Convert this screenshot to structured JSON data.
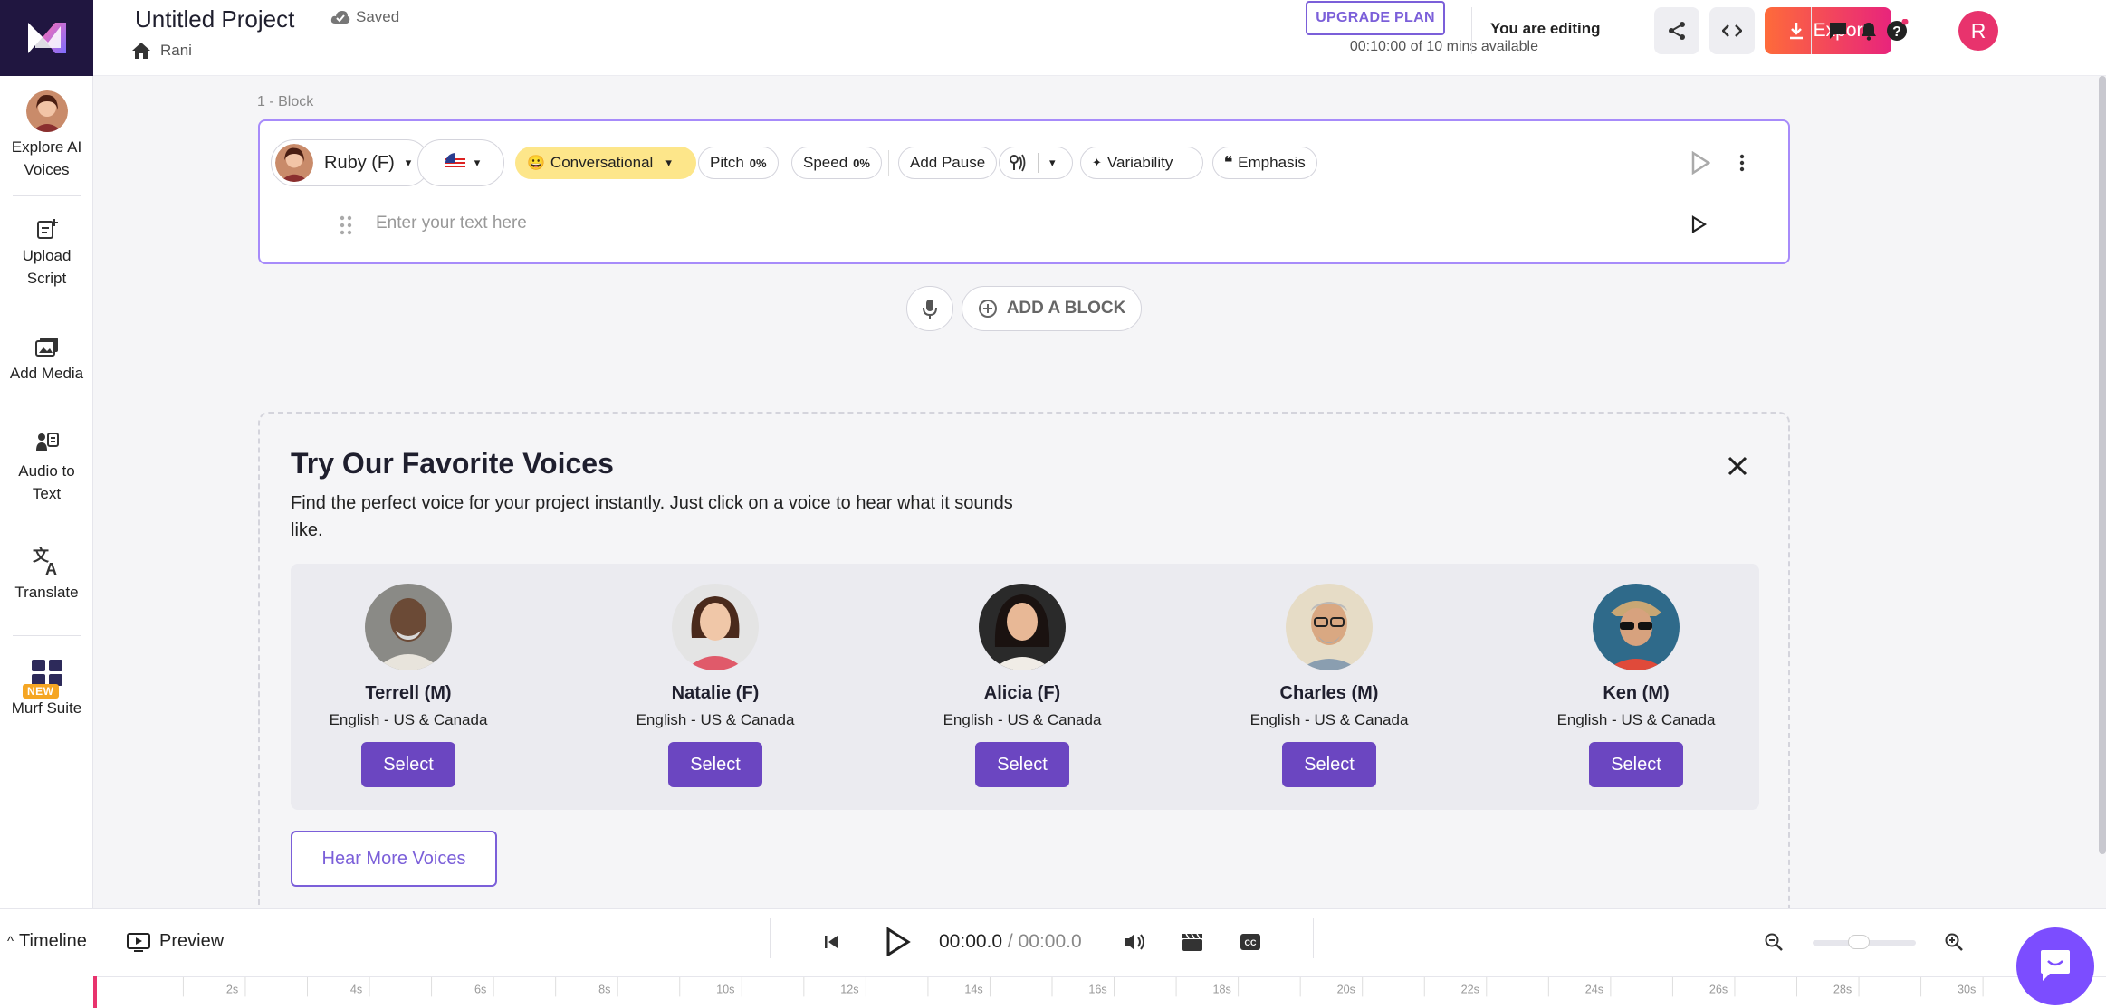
{
  "sidebar": {
    "items": [
      {
        "label": "Explore AI Voices",
        "icon": "voice-avatar-icon"
      },
      {
        "label": "Upload Script",
        "icon": "upload-script-icon"
      },
      {
        "label": "Add Media",
        "icon": "media-icon"
      },
      {
        "label": "Audio to Text",
        "icon": "audio-to-text-icon"
      },
      {
        "label": "Translate",
        "icon": "translate-icon"
      },
      {
        "label": "Murf Suite",
        "icon": "grid-icon",
        "badge": "NEW"
      }
    ]
  },
  "header": {
    "project_title": "Untitled Project",
    "saved_label": "Saved",
    "breadcrumb": "Rani",
    "upgrade_label": "UPGRADE PLAN",
    "availability": "00:10:00 of 10 mins available",
    "editing_label": "You are editing",
    "export_label": "Export",
    "user_initial": "R"
  },
  "block": {
    "label": "1 -  Block",
    "voice_name": "Ruby (F)",
    "style": "Conversational",
    "pitch_label": "Pitch",
    "pitch_value": "0%",
    "speed_label": "Speed",
    "speed_value": "0%",
    "add_pause_label": "Add Pause",
    "variability_label": "Variability",
    "emphasis_label": "Emphasis",
    "text_placeholder": "Enter your text here"
  },
  "add_block_label": "ADD A BLOCK",
  "favorites": {
    "title": "Try Our Favorite Voices",
    "description": "Find the perfect voice for your project instantly. Just click on a voice to hear what it sounds like.",
    "voices": [
      {
        "name": "Terrell (M)",
        "lang": "English - US & Canada",
        "select": "Select"
      },
      {
        "name": "Natalie (F)",
        "lang": "English - US & Canada",
        "select": "Select"
      },
      {
        "name": "Alicia (F)",
        "lang": "English - US & Canada",
        "select": "Select"
      },
      {
        "name": "Charles (M)",
        "lang": "English - US & Canada",
        "select": "Select"
      },
      {
        "name": "Ken (M)",
        "lang": "English - US & Canada",
        "select": "Select"
      }
    ],
    "hear_more_label": "Hear More Voices"
  },
  "bottom": {
    "timeline_label": "Timeline",
    "preview_label": "Preview",
    "current_time": "00:00.0",
    "total_time": " / 00:00.0",
    "ruler_ticks": [
      "2s",
      "4s",
      "6s",
      "8s",
      "10s",
      "12s",
      "14s",
      "16s",
      "18s",
      "20s",
      "22s",
      "24s",
      "26s",
      "28s",
      "30s"
    ]
  },
  "colors": {
    "accent": "#7b5fd9",
    "select_button": "#6b46c1",
    "export_gradient_start": "#fe6b3a",
    "export_gradient_end": "#e8247c",
    "logo_bg": "#201640"
  }
}
